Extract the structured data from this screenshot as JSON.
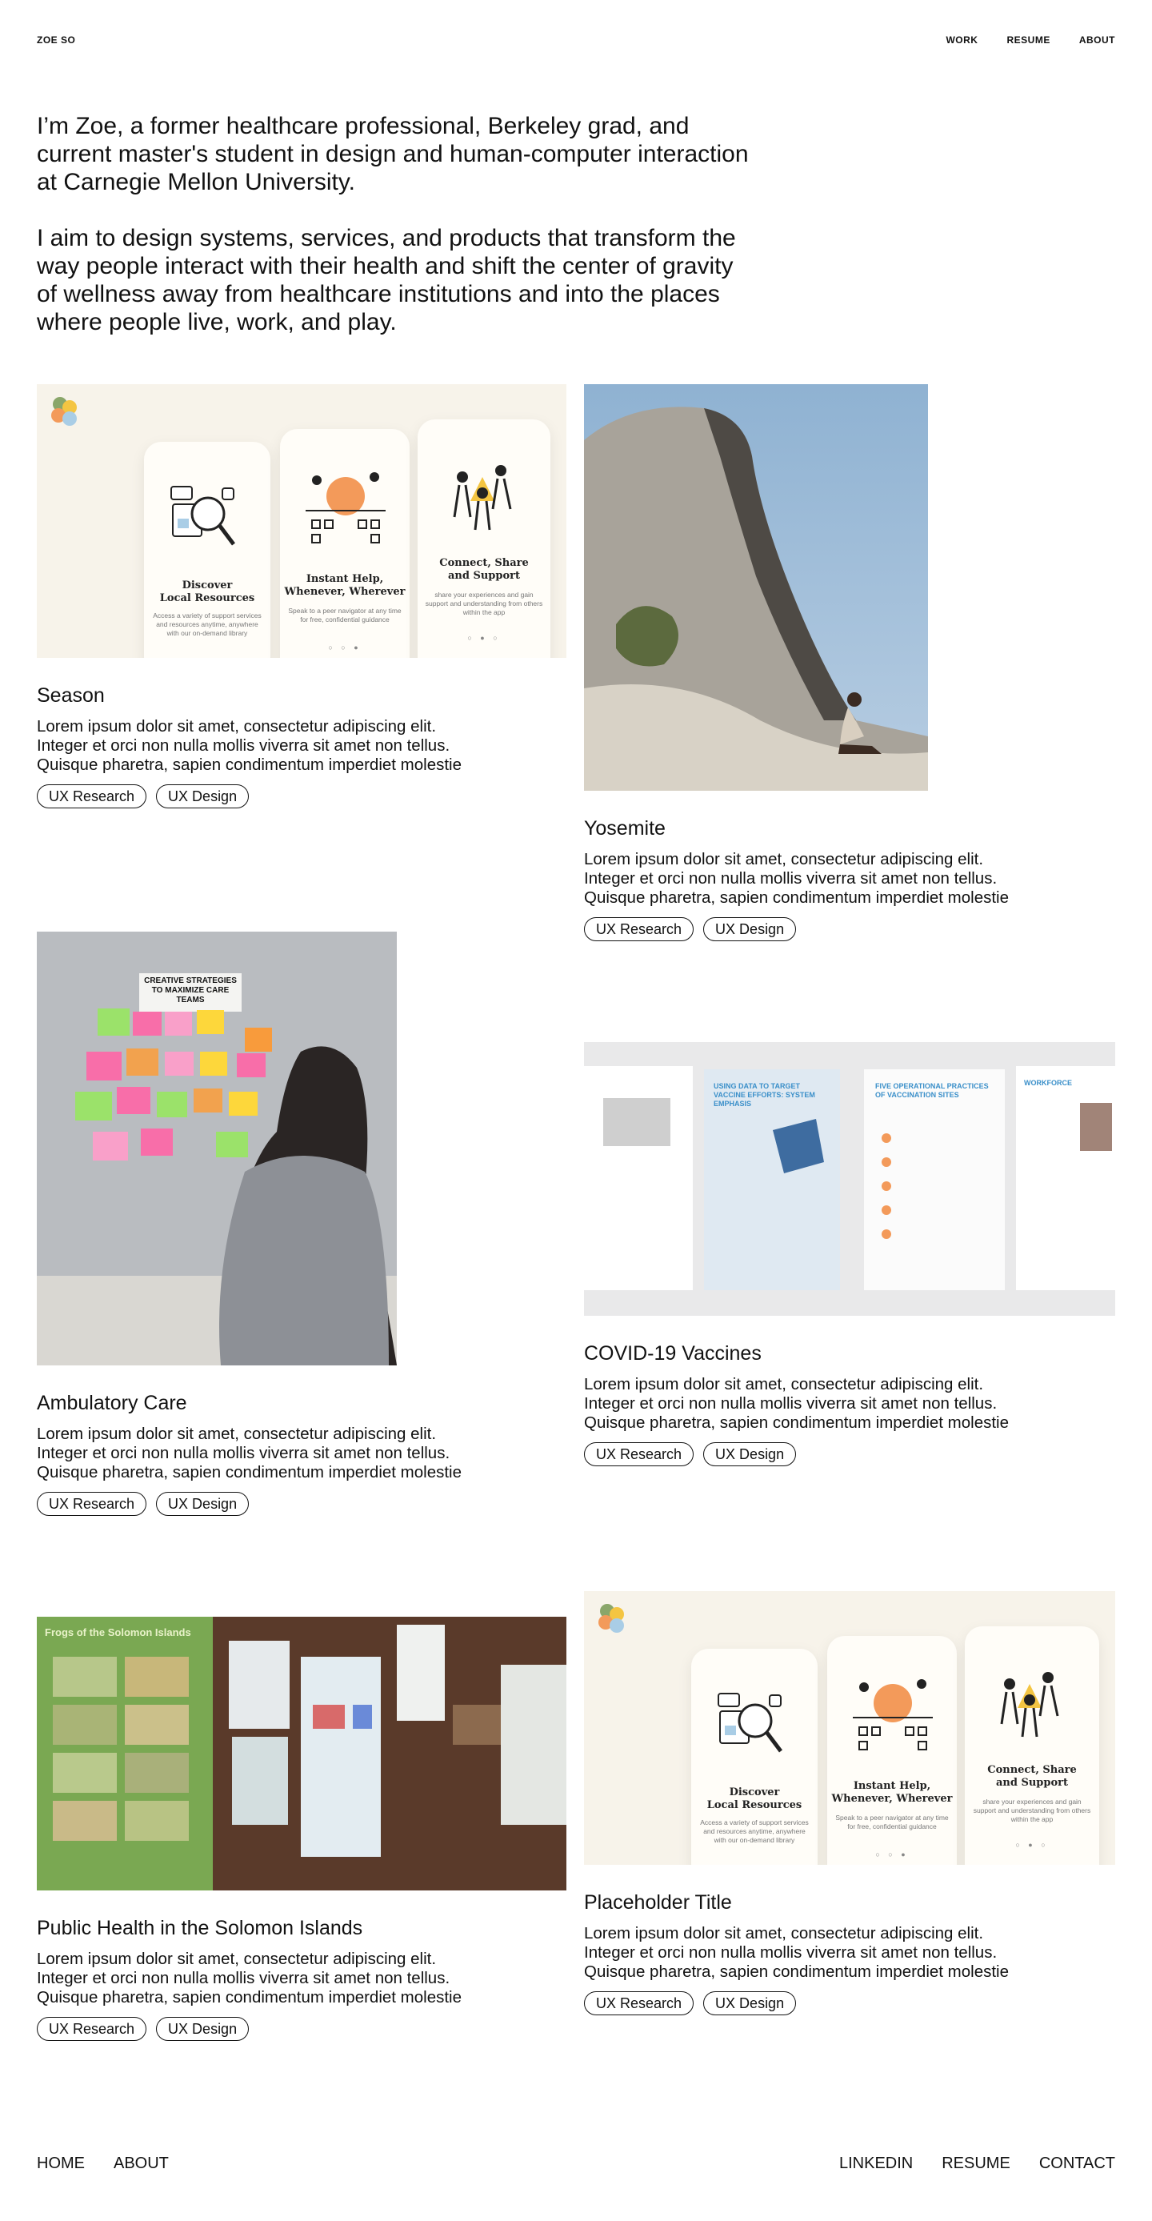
{
  "header": {
    "brand": "ZOE SO",
    "nav": [
      "WORK",
      "RESUME",
      "ABOUT"
    ]
  },
  "intro": {
    "p1": "I’m Zoe, a former healthcare professional, Berkeley grad, and current master's student in design and human-computer interaction at Carnegie Mellon University.",
    "p2": "I aim to design systems, services, and products that transform the way people interact with their health and shift the center of gravity of wellness away from healthcare institutions and into the places where people live, work, and play."
  },
  "app_screens": [
    {
      "title": "Discover\nLocal Resources",
      "sub": "Access a variety of support services and resources anytime, anywhere with our on-demand library"
    },
    {
      "title": "Instant Help,\nWhenever, Wherever",
      "sub": "Speak to a peer navigator at any time for free, confidential guidance"
    },
    {
      "title": "Connect, Share\nand Support",
      "sub": "share your experiences and gain support and understanding from others within the app"
    }
  ],
  "booklet": {
    "heading_left": "USING DATA TO TARGET VACCINE EFFORTS: SYSTEM EMPHASIS",
    "heading_right": "FIVE OPERATIONAL PRACTICES OF VACCINATION SITES",
    "heading_far": "WORKFORCE"
  },
  "projects": [
    {
      "title": "Season",
      "desc": "Lorem ipsum dolor sit amet, consectetur adipiscing elit. Integer et orci non nulla mollis viverra sit amet non tellus. Quisque pharetra, sapien condimentum imperdiet molestie",
      "tags": [
        "UX Research",
        "UX Design"
      ]
    },
    {
      "title": "Yosemite",
      "desc": "Lorem ipsum dolor sit amet, consectetur adipiscing elit. Integer et orci non nulla mollis viverra sit amet non tellus. Quisque pharetra, sapien condimentum imperdiet molestie",
      "tags": [
        "UX Research",
        "UX Design"
      ]
    },
    {
      "title": "Ambulatory Care",
      "desc": "Lorem ipsum dolor sit amet, consectetur adipiscing elit. Integer et orci non nulla mollis viverra sit amet non tellus. Quisque pharetra, sapien condimentum imperdiet molestie",
      "tags": [
        "UX Research",
        "UX Design"
      ],
      "poster": "CREATIVE STRATEGIES TO MAXIMIZE CARE TEAMS"
    },
    {
      "title": "COVID-19 Vaccines",
      "desc": "Lorem ipsum dolor sit amet, consectetur adipiscing elit. Integer et orci non nulla mollis viverra sit amet non tellus. Quisque pharetra, sapien condimentum imperdiet molestie",
      "tags": [
        "UX Research",
        "UX Design"
      ]
    },
    {
      "title": "Public Health in the Solomon Islands",
      "desc": "Lorem ipsum dolor sit amet, consectetur adipiscing elit. Integer et orci non nulla mollis viverra sit amet non tellus. Quisque pharetra, sapien condimentum imperdiet molestie",
      "tags": [
        "UX Research",
        "UX Design"
      ],
      "poster": "Frogs of the Solomon Islands"
    },
    {
      "title": "Placeholder Title",
      "desc": "Lorem ipsum dolor sit amet, consectetur adipiscing elit. Integer et orci non nulla mollis viverra sit amet non tellus. Quisque pharetra, sapien condimentum imperdiet molestie",
      "tags": [
        "UX Research",
        "UX Design"
      ]
    }
  ],
  "footer": {
    "left": [
      "HOME",
      "ABOUT"
    ],
    "right": [
      "LINKEDIN",
      "RESUME",
      "CONTACT"
    ]
  },
  "colors": {
    "accent_orange": "#f39a5a",
    "accent_yellow": "#f4c542",
    "accent_green": "#8aa66a",
    "accent_blue": "#a9cde6"
  }
}
